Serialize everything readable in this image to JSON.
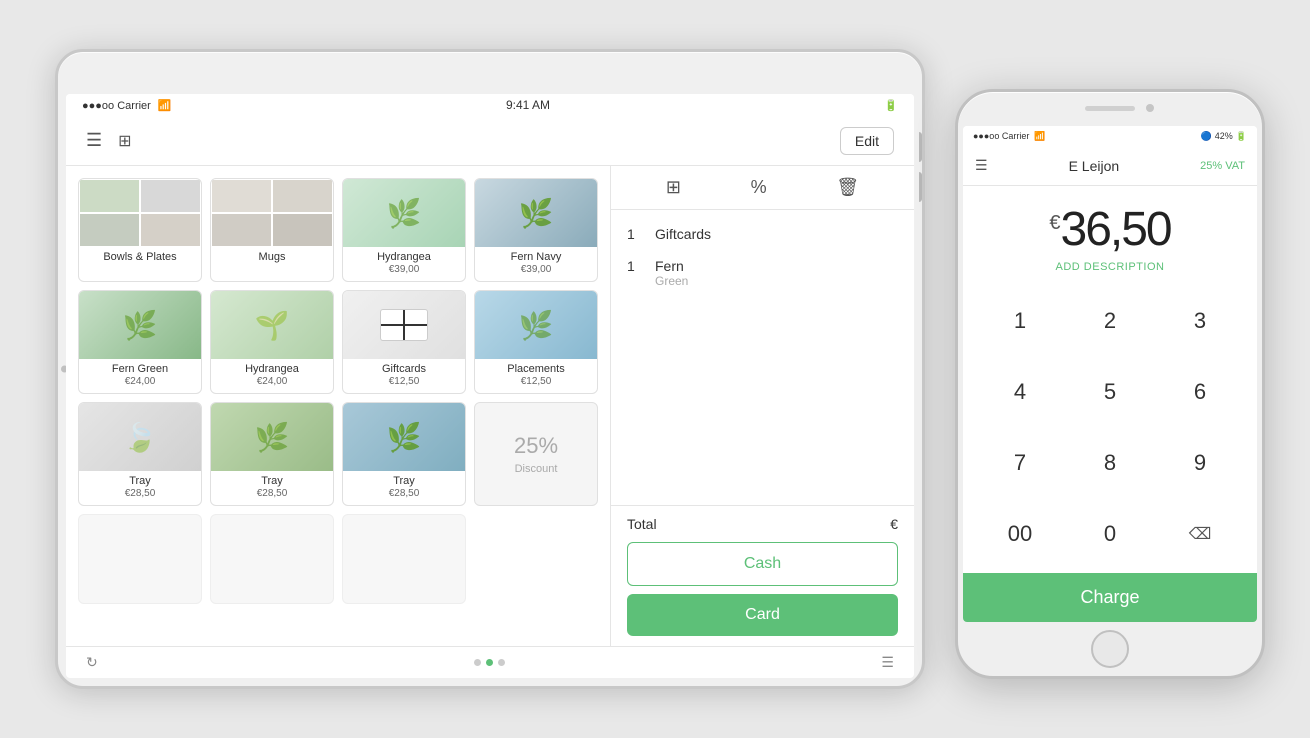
{
  "scene": {
    "background": "#e8e8e8"
  },
  "tablet": {
    "status_bar": {
      "carrier": "●●●oo Carrier",
      "wifi": "WiFi",
      "time": "9:41 AM"
    },
    "header": {
      "edit_label": "Edit"
    },
    "products": [
      {
        "id": "bowls-plates",
        "name": "Bowls & Plates",
        "price": "",
        "category": true,
        "emoji": "🍽"
      },
      {
        "id": "mugs",
        "name": "Mugs",
        "price": "",
        "category": true,
        "emoji": "☕"
      },
      {
        "id": "hydrangea",
        "name": "Hydrangea",
        "price": "€39,00",
        "category": false,
        "emoji": "🌿"
      },
      {
        "id": "fern-navy",
        "name": "Fern Navy",
        "price": "€39,00",
        "category": false,
        "emoji": "🌿"
      },
      {
        "id": "fern-green",
        "name": "Fern Green",
        "price": "€24,00",
        "category": false,
        "emoji": "🌿"
      },
      {
        "id": "hydrangea2",
        "name": "Hydrangea",
        "price": "€24,00",
        "category": false,
        "emoji": "🌿"
      },
      {
        "id": "giftcards",
        "name": "Giftcards",
        "price": "€12,50",
        "category": false,
        "emoji": "🎁"
      },
      {
        "id": "placements",
        "name": "Placements",
        "price": "€12,50",
        "category": false,
        "emoji": "🌿"
      },
      {
        "id": "tray1",
        "name": "Tray",
        "price": "€28,50",
        "category": false,
        "emoji": "🍃"
      },
      {
        "id": "tray2",
        "name": "Tray",
        "price": "€28,50",
        "category": false,
        "emoji": "🌿"
      },
      {
        "id": "tray3",
        "name": "Tray",
        "price": "€28,50",
        "category": false,
        "emoji": "🌿"
      },
      {
        "id": "discount",
        "name": "Discount",
        "price": "",
        "category": false,
        "discount": true,
        "pct": "25%"
      }
    ],
    "cart": {
      "items": [
        {
          "qty": "1",
          "name": "Giftcards",
          "sub": ""
        },
        {
          "qty": "1",
          "name": "Fern",
          "sub": "Green"
        }
      ],
      "total_label": "Total",
      "total_currency": "€",
      "cash_label": "Cash",
      "card_label": "Card"
    },
    "bottom": {
      "page_dots": [
        false,
        true,
        false
      ]
    }
  },
  "phone": {
    "status_bar": {
      "carrier": "●●●oo Carrier",
      "wifi": "WiFi",
      "battery": "42%",
      "bluetooth": "BT"
    },
    "header": {
      "store_name": "E Leijon",
      "vat_label": "25% VAT"
    },
    "amount": {
      "currency": "€",
      "value": "36,50"
    },
    "add_desc_label": "ADD DESCRIPTION",
    "numpad": {
      "keys": [
        "1",
        "2",
        "3",
        "4",
        "5",
        "6",
        "7",
        "8",
        "9",
        "00",
        "0",
        "⌫"
      ]
    },
    "charge_label": "Charge"
  }
}
